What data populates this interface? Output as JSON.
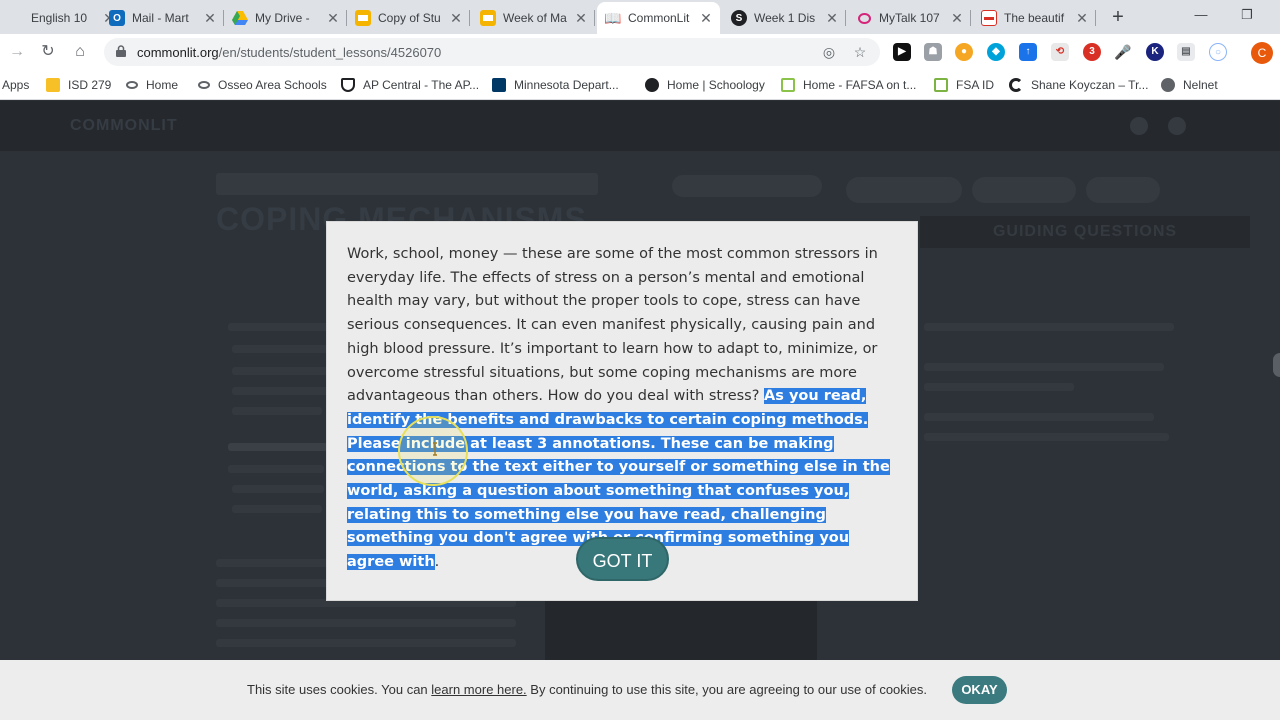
{
  "browser": {
    "tabs": [
      {
        "title": "English 10",
        "icon": "doc-icon",
        "color": "#e8eaed"
      },
      {
        "title": "Mail - Mart",
        "icon": "outlook-icon",
        "color": "#0f6cbd"
      },
      {
        "title": "My Drive -",
        "icon": "drive-icon",
        "color": "#fbbc04"
      },
      {
        "title": "Copy of Stu",
        "icon": "slides-icon",
        "color": "#f4b400"
      },
      {
        "title": "Week of Ma",
        "icon": "slides-icon",
        "color": "#f4b400"
      },
      {
        "title": "CommonLit",
        "icon": "commonlit-icon",
        "color": "#202124"
      },
      {
        "title": "Week 1 Dis",
        "icon": "schoology-icon",
        "color": "#202124"
      },
      {
        "title": "MyTalk 107",
        "icon": "chat-icon",
        "color": "#d6247a"
      },
      {
        "title": "The beautif",
        "icon": "news-icon",
        "color": "#d93025"
      }
    ],
    "new_tab": "+",
    "url_host": "commonlit.org",
    "url_path": "/en/students/student_lessons/4526070",
    "profile_initial": "C",
    "bookmarks": [
      {
        "label": "Apps",
        "icon": "apps-icon"
      },
      {
        "label": "ISD 279",
        "icon": "folder-icon"
      },
      {
        "label": "Home",
        "icon": "link-icon"
      },
      {
        "label": "Osseo Area Schools",
        "icon": "link-icon"
      },
      {
        "label": "AP Central - The AP...",
        "icon": "shield-icon"
      },
      {
        "label": "Minnesota Depart...",
        "icon": "mn-icon"
      },
      {
        "label": "Home | Schoology",
        "icon": "schoology-icon"
      },
      {
        "label": "Home - FAFSA on t...",
        "icon": "fafsa-icon"
      },
      {
        "label": "FSA ID",
        "icon": "fsa-icon"
      },
      {
        "label": "Shane Koyczan – Tr...",
        "icon": "spiral-icon"
      },
      {
        "label": "Nelnet",
        "icon": "globe-icon"
      }
    ]
  },
  "page": {
    "logo": "COMMONLIT",
    "title": "COPING MECHANISMS",
    "guide_tab": "GUIDING QUESTIONS"
  },
  "modal": {
    "intro": "Work, school, money — these are some of the most common stressors in everyday life. The effects of stress on a person’s mental and emotional health may vary, but without the proper tools to cope, stress can have serious consequences. It can even manifest physically, causing pain and high blood pressure. It’s important to learn how to adapt to, minimize, or overcome stressful situations, but some coping mechanisms are more advantageous than others. How do you deal with stress? ",
    "highlighted": "As you read, identify the benefits and drawbacks to certain coping methods. Please include at least 3 annotations. These can be making connections to the text either to yourself or something else in the world, asking a question about something that confuses you, relating this to something else you have read, challenging something you don't agree with or confirming something you agree with",
    "end": ".",
    "button": "GOT IT"
  },
  "cookie": {
    "before": "This site uses cookies. You can ",
    "link": "learn more here.",
    "after": " By continuing to use this site, you are agreeing to our use of cookies.",
    "button": "OKAY"
  }
}
